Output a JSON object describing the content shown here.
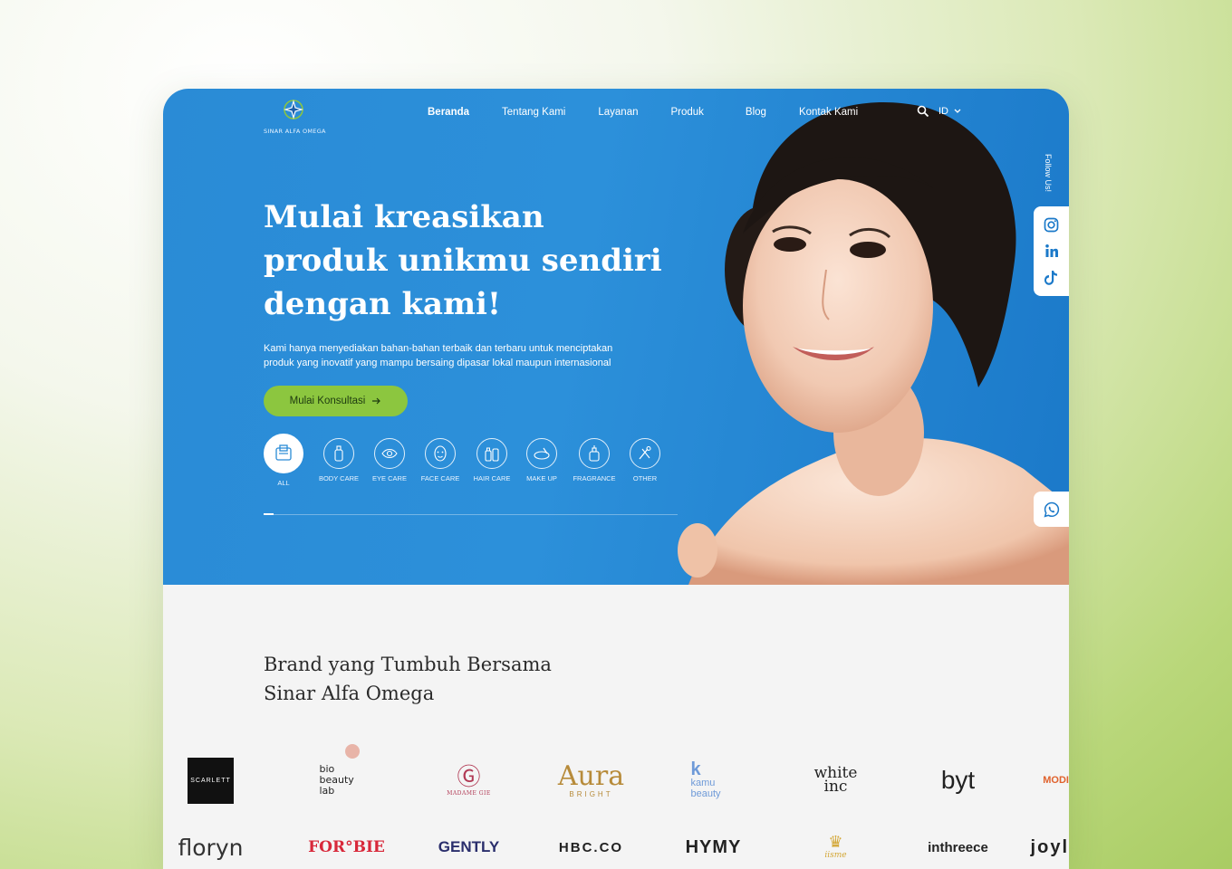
{
  "logo": {
    "name": "SINAR ALFA OMEGA"
  },
  "nav": {
    "items": [
      {
        "label": "Beranda",
        "active": true
      },
      {
        "label": "Tentang Kami",
        "active": false
      },
      {
        "label": "Layanan",
        "active": false
      },
      {
        "label": "Produk",
        "active": false
      },
      {
        "label": "Blog",
        "active": false
      },
      {
        "label": "Kontak Kami",
        "active": false
      }
    ],
    "language": "ID"
  },
  "hero": {
    "headline_line1": "Mulai kreasikan",
    "headline_line2": "produk unikmu sendiri",
    "headline_line3": "dengan kami!",
    "sub_line1": "Kami hanya menyediakan bahan-bahan terbaik dan terbaru untuk menciptakan",
    "sub_line2": "produk yang inovatif yang mampu bersaing dipasar lokal maupun internasional",
    "cta_label": "Mulai Konsultasi"
  },
  "categories": [
    {
      "label": "ALL",
      "icon": "all-products-icon",
      "selected": true
    },
    {
      "label": "BODY CARE",
      "icon": "body-care-icon",
      "selected": false
    },
    {
      "label": "EYE CARE",
      "icon": "eye-care-icon",
      "selected": false
    },
    {
      "label": "FACE CARE",
      "icon": "face-care-icon",
      "selected": false
    },
    {
      "label": "HAIR CARE",
      "icon": "hair-care-icon",
      "selected": false
    },
    {
      "label": "MAKE UP",
      "icon": "make-up-icon",
      "selected": false
    },
    {
      "label": "FRAGRANCE",
      "icon": "fragrance-icon",
      "selected": false
    },
    {
      "label": "OTHER",
      "icon": "other-icon",
      "selected": false
    }
  ],
  "social": {
    "follow_label": "Follow Us!",
    "icons": [
      "instagram-icon",
      "linkedin-icon",
      "tiktok-icon"
    ],
    "whatsapp": "whatsapp-icon"
  },
  "brands_section": {
    "title_line1": "Brand yang Tumbuh Bersama",
    "title_line2": "Sinar Alfa Omega",
    "row1": [
      "SCARLETT",
      "bio beauty lab",
      "MADAME GIE",
      "Aura",
      "kamu beauty",
      "white inc",
      "byt",
      "MODI"
    ],
    "row2": [
      "floryn",
      "FOR°BIE",
      "GENTLY",
      "HBC.CO",
      "HYMY",
      "iisme",
      "inthreece",
      "joyl"
    ]
  },
  "colors": {
    "hero_blue": "#2a8bd6",
    "accent_green": "#8cc63f",
    "section_bg": "#f4f4f4"
  }
}
